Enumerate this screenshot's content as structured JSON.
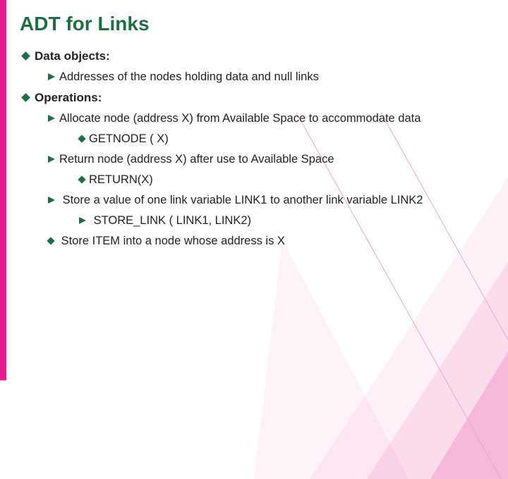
{
  "title": "ADT for  Links",
  "sections": {
    "data_objects": {
      "heading": "Data objects:",
      "item1": "Addresses of the nodes holding data and null links"
    },
    "operations": {
      "heading": "Operations:",
      "op1": "Allocate node (address X)  from Available Space to accommodate data",
      "op1_sub": "GETNODE ( X)",
      "op2": "Return node (address X) after use to Available  Space",
      "op2_sub": "RETURN(X)",
      "op3": " Store a  value of one link variable LINK1 to another link variable LINK2",
      "op3_sub": " STORE_LINK ( LINK1, LINK2)",
      "op4": " Store  ITEM into  a node whose address is X"
    }
  }
}
